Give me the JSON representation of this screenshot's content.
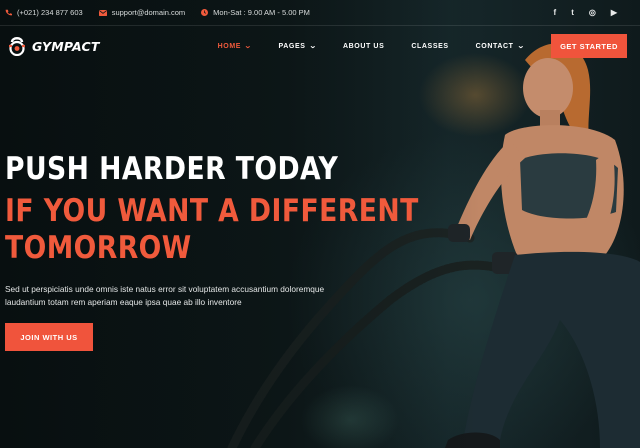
{
  "topbar": {
    "phone": "(+021) 234 877 603",
    "email": "support@domain.com",
    "hours": "Mon-Sat : 9.00 AM - 5.00 PM",
    "social": [
      {
        "icon": "facebook-icon",
        "glyph": "f"
      },
      {
        "icon": "twitter-icon",
        "glyph": "t"
      },
      {
        "icon": "instagram-icon",
        "glyph": "◎"
      },
      {
        "icon": "youtube-icon",
        "glyph": "▶"
      }
    ]
  },
  "brand": {
    "name": "GYMPACT",
    "logo_icon": "kettlebell-icon"
  },
  "nav": {
    "items": [
      {
        "label": "HOME",
        "has_dropdown": true,
        "active": true
      },
      {
        "label": "PAGES",
        "has_dropdown": true,
        "active": false
      },
      {
        "label": "ABOUT US",
        "has_dropdown": false,
        "active": false
      },
      {
        "label": "CLASSES",
        "has_dropdown": false,
        "active": false
      },
      {
        "label": "CONTACT",
        "has_dropdown": true,
        "active": false
      }
    ],
    "cta_label": "GET STARTED"
  },
  "hero": {
    "headline_1": "PUSH HARDER TODAY",
    "headline_2": "IF YOU WANT A DIFFERENT",
    "headline_3": "TOMORROW",
    "description": "Sed ut perspiciatis unde omnis iste natus error sit voluptatem accusantium doloremque laudantium totam rem aperiam eaque ipsa quae ab illo inventore",
    "button_label": "JOIN WITH US"
  },
  "colors": {
    "accent": "#f05a3c",
    "background": "#0d1516",
    "text": "#ffffff"
  }
}
